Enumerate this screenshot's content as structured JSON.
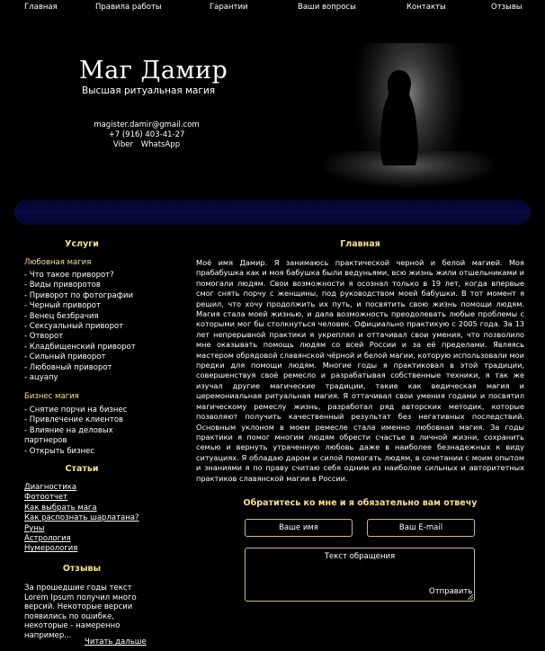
{
  "nav": [
    {
      "label": "Главная"
    },
    {
      "label": "Правила работы"
    },
    {
      "label": "Гарантии"
    },
    {
      "label": "Ваши вопросы"
    },
    {
      "label": "Контакты"
    },
    {
      "label": "Отзывы"
    }
  ],
  "header": {
    "title": "Маг Дамир",
    "subtitle": "Высшая ритуальная магия",
    "email": "magister.damir@gmail.com",
    "phone": "+7 (916) 403-41-27",
    "messengers": [
      "Viber",
      "WhatsApp"
    ]
  },
  "sidebar": {
    "services_heading": "Услуги",
    "love_magic": {
      "title": "Любовная магия",
      "items": [
        "- Что такое приворот?",
        "- Виды приворотов",
        "- Приворот по фотографии",
        "- Черный приворот",
        "- Венец безбрачия",
        "- Сексуальный приворот",
        "- Отворот",
        "- Кладбищенский приворот",
        "- Сильный приворот",
        "- Любовный приворот",
        "- ацуапу"
      ]
    },
    "business_magic": {
      "title": "Бизнес магия",
      "items": [
        "- Снятие порчи на бизнес",
        "- Привлечение клиентов",
        "- Влияние на деловых партнеров",
        "- Открыть бизнес"
      ]
    },
    "articles_heading": "Статьи",
    "articles": [
      "Диагностика",
      "Фотоотчет",
      "Как выбрать мага",
      "Как распознать шарлатана?",
      "Руны",
      "Астрология",
      "Нумерология"
    ],
    "reviews_heading": "Отзывы",
    "review_text": "За прошедшие годы текст Lorem Ipsum получил много версий. Некоторые версии появились по ошибке, некоторые - намеренно например...",
    "read_more": "Читать дальше"
  },
  "main": {
    "heading": "Главная",
    "text": "Моё имя Дамир. Я занимаюсь практической черной и белой магией. Моя прабабушка как и моя бабушка были ведуньями, всю жизнь жили отшельниками и помогали людям. Свои возможности я осознал только в 19 лет, когда впервые смог снять порчу с женщины, под руководством моей бабушки. В тот момент я решил, что хочу продолжить их путь, и посвятить свою жизнь помощи людям. Магия стала моей жизнью, и дала возможность преодолевать любые проблемы с которыми мог бы столкнуться человек. Официально практикую с 2005 года. За 13 лет непрерывной практики я укреплял и оттачивал свои умения, что позволило мне оказывать помощь людям со всей России и за её пределами. Являясь мастером обрядовой славянской чёрной и белой магии, которую использовали мои предки для помощи людям. Многие годы я практиковал в этой традиции, совершенствуя своё ремесло и разрабатывая собственные техники, я так же изучал другие магические традиции, такие как ведическая магия и церемониальная ритуальная магия. Я оттачивал свои умения годами и посвятил магическому ремеслу жизнь, разработал ряд авторских методик, которые позволяют получить качественный результат без негативных последствий. Основным уклоном в моем ремесле стала именно любовная магия. За годы практики я помог многим людям обрести счастье в личной жизни, сохранить семью и вернуть утраченную любовь даже в наиболее безнадежных к виду ситуациях. Я обладаю даром и силой помогать людям, в сочетании с моим опытом и знаниями я по праву считаю себя одним из наиболее сильных и авторитетных практиков славянской магии в России."
  },
  "form": {
    "heading": "Обратитесь ко мне и я обязательно вам отвечу",
    "name_placeholder": "Ваше имя",
    "email_placeholder": "Ваш E-mail",
    "message_placeholder": "Текст обращения",
    "submit_label": "Отправить"
  },
  "colors": {
    "background": "#000000",
    "accent": "#f5e08e",
    "header_bar": "#0a0c44",
    "field_border": "#c9b88a"
  }
}
